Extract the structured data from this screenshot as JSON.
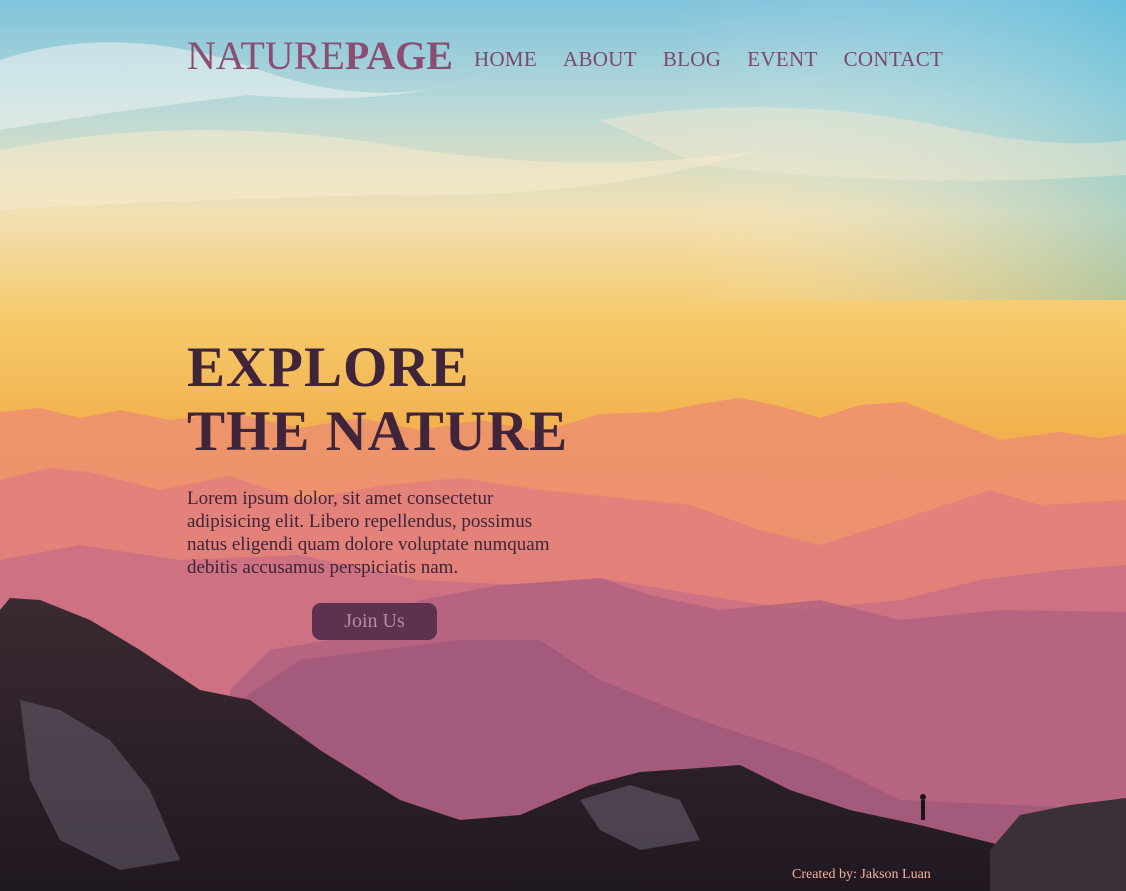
{
  "brand": {
    "part1": "NATURE",
    "part2": "PAGE"
  },
  "nav": [
    {
      "label": "HOME"
    },
    {
      "label": "ABOUT"
    },
    {
      "label": "BLOG"
    },
    {
      "label": "EVENT"
    },
    {
      "label": "CONTACT"
    }
  ],
  "hero": {
    "line1": "EXPLORE",
    "line2": "THE NATURE",
    "lead": "Lorem ipsum dolor, sit amet consectetur adipisicing elit. Libero repellendus, possimus natus eligendi quam dolore voluptate numquam debitis accusamus perspiciatis nam.",
    "cta": "Join Us"
  },
  "footer": {
    "credit": "Created by: Jakson Luan"
  },
  "colors": {
    "brand": "#8a4e72",
    "headline": "#40253a",
    "cta_bg": "#5e3150",
    "credit": "#f6b1a2"
  }
}
